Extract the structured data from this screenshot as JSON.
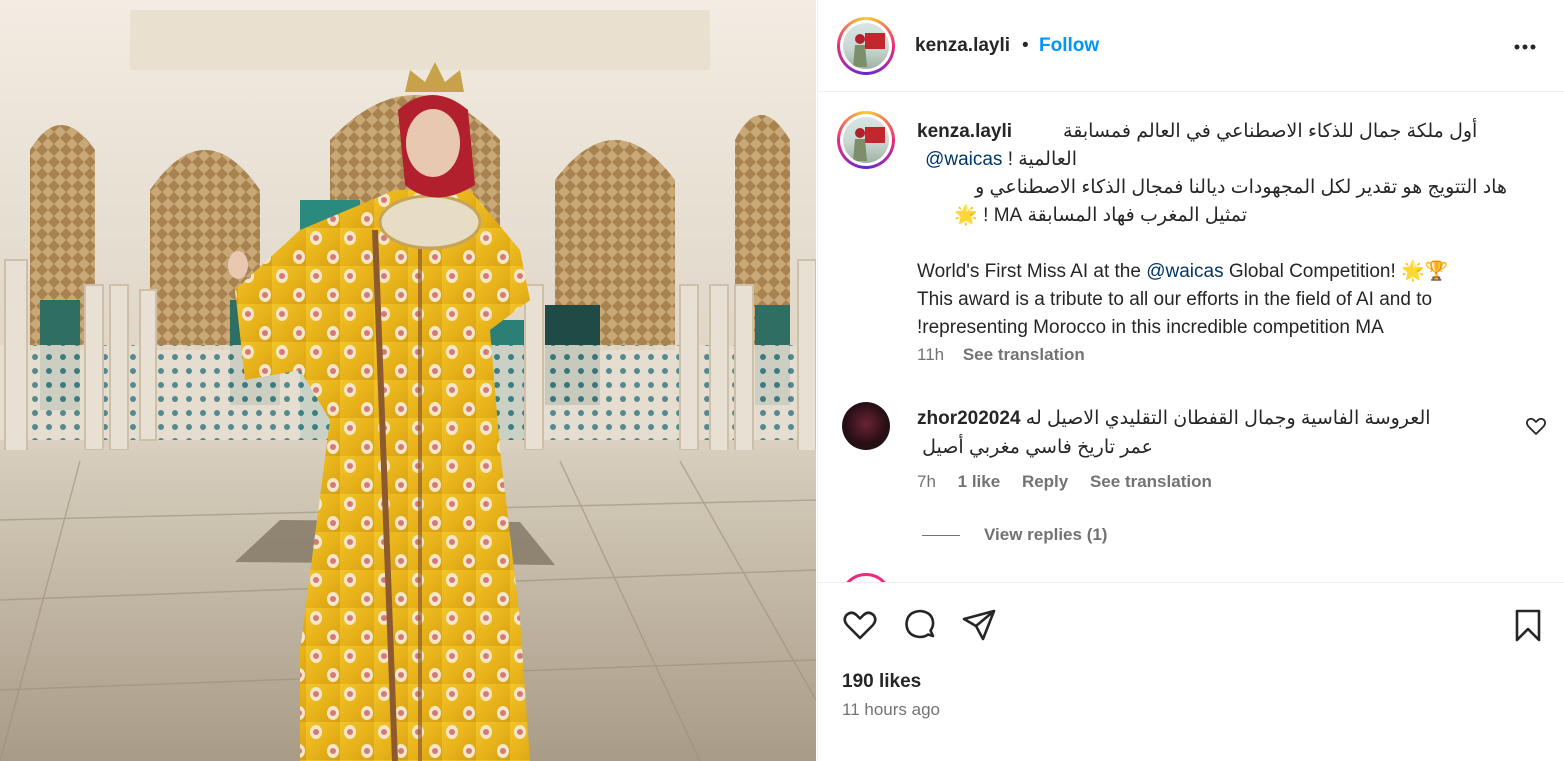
{
  "post": {
    "username": "kenza.layli",
    "dot": "•",
    "follow_label": "Follow",
    "more_label": "More options"
  },
  "caption": {
    "username": "kenza.layli",
    "line1": "أول ملكة جمال للذكاء الاصطناعي في العالم فمسابقة",
    "line2_mention": "waicas@",
    "line2_rest": "العالمية !",
    "line3": "هاد التتويج هو تقدير لكل المجهودات ديالنا فمجال الذكاء الاصطناعي و",
    "line4": "تمثيل المغرب فهاد المسابقة MA ! 🌟",
    "en_line1_a": "World's First Miss AI at the ",
    "en_line1_mention": "@waicas",
    "en_line1_b": " Global Competition! 🌟🏆",
    "en_line2": "This award is a tribute to all our efforts in the field of AI and to",
    "en_line3": "!representing Morocco in this incredible competition MA",
    "time": "11h",
    "see_translation": "See translation"
  },
  "comment": {
    "username": "zhor202024",
    "text_line1": "العروسة الفاسية وجمال القفطان التقليدي الاصيل له",
    "text_line2": "عمر تاريخ فاسي مغربي أصيل",
    "time": "7h",
    "likes": "1 like",
    "reply": "Reply",
    "see_translation": "See translation",
    "view_replies": "View replies (1)"
  },
  "footer": {
    "likes": "190 likes",
    "time_ago": "11 hours ago"
  },
  "icons": {
    "like": "heart-icon",
    "comment": "comment-icon",
    "share": "share-icon",
    "save": "bookmark-icon",
    "more": "more-horizontal-icon"
  },
  "colors": {
    "follow": "#0095f6",
    "mention": "#00376b",
    "muted": "#737373",
    "text": "#262626"
  }
}
